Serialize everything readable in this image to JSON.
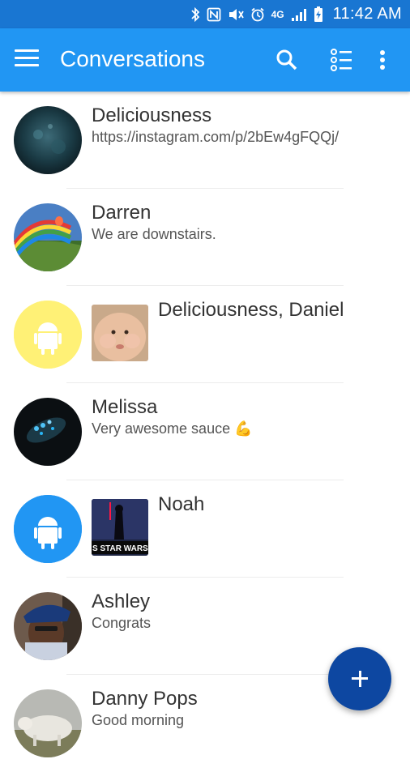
{
  "status_bar": {
    "time": "11:42 AM",
    "icons": [
      "bluetooth-icon",
      "nfc-icon",
      "mute-icon",
      "alarm-icon",
      "4g-lte-icon",
      "signal-icon",
      "battery-charging-icon"
    ],
    "network_label": "4G"
  },
  "app_bar": {
    "title": "Conversations",
    "actions": [
      "menu-icon",
      "search-icon",
      "select-list-icon",
      "overflow-menu-icon"
    ]
  },
  "conversations": [
    {
      "name": "Deliciousness",
      "snippet": "https://instagram.com/p/2bEw4gFQQj/",
      "avatar": "photo"
    },
    {
      "name": "Darren",
      "snippet": "We are downstairs.",
      "avatar": "photo"
    },
    {
      "name": "Deliciousness, Daniel",
      "snippet": "",
      "avatar": "android",
      "avatar_color": "#fff176",
      "attachment": "baby-photo"
    },
    {
      "name": "Melissa",
      "snippet": "Very awesome sauce 💪",
      "avatar": "photo"
    },
    {
      "name": "Noah",
      "snippet": "",
      "avatar": "android",
      "avatar_color": "#2196f3",
      "attachment": "star-wars-photo",
      "attachment_caption": "S STAR WARS DA"
    },
    {
      "name": "Ashley",
      "snippet": "Congrats",
      "avatar": "photo"
    },
    {
      "name": "Danny Pops",
      "snippet": "Good morning",
      "avatar": "photo"
    }
  ],
  "fab": {
    "icon": "plus-icon"
  },
  "colors": {
    "status_bar": "#1976d2",
    "app_bar": "#2196f3",
    "fab": "#0d47a1"
  }
}
